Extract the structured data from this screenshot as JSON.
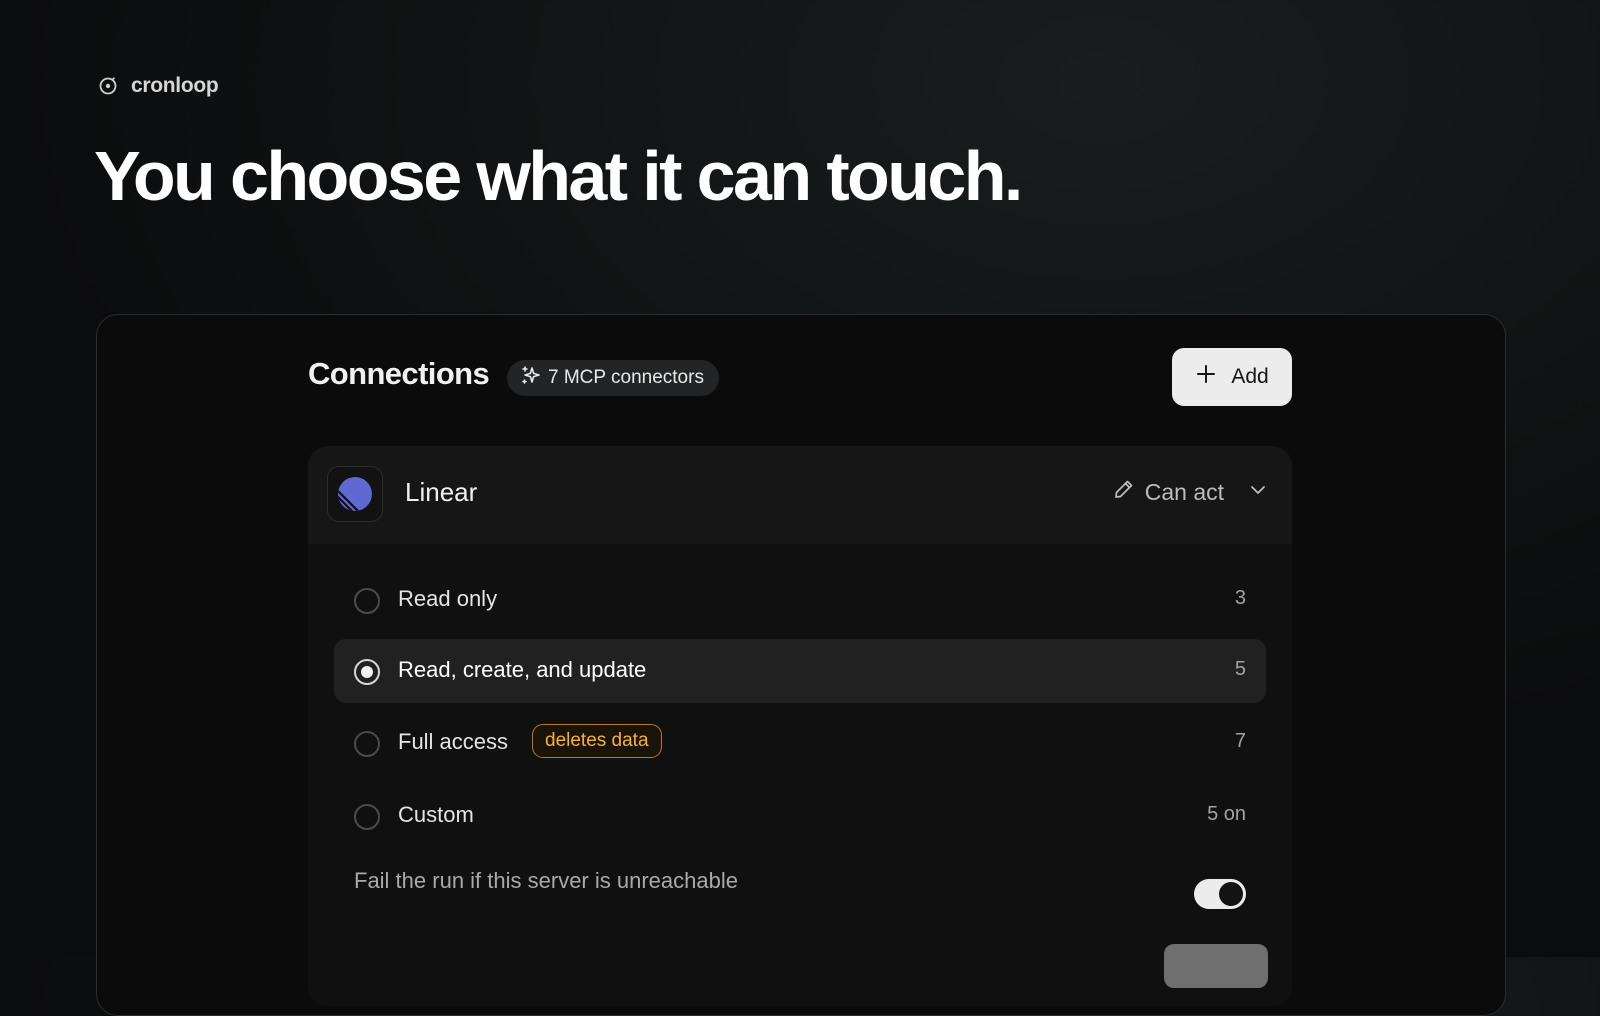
{
  "brand": {
    "name": "cronloop",
    "icon": "circle-dot-icon"
  },
  "headline": "You choose what it can touch.",
  "connections": {
    "title": "Connections",
    "badge": {
      "icon": "sparkle-icon",
      "label": "7 MCP connectors"
    },
    "add_button": {
      "icon": "plus-icon",
      "label": "Add"
    }
  },
  "connector": {
    "name": "Linear",
    "logo": "linear-logo-icon",
    "permission": {
      "icon": "pencil-icon",
      "label": "Can act",
      "dropdown_icon": "chevron-down-icon"
    },
    "options": [
      {
        "label": "Read only",
        "count": "3",
        "selected": false
      },
      {
        "label": "Read, create, and update",
        "count": "5",
        "selected": true
      },
      {
        "label": "Full access",
        "count": "7",
        "selected": false,
        "badge": "deletes data"
      },
      {
        "label": "Custom",
        "count": "5 on",
        "selected": false
      }
    ],
    "fail_toggle": {
      "label": "Fail the run if this server is unreachable",
      "enabled": true
    }
  },
  "colors": {
    "accent_linear": "#5e6ad2",
    "warning": "#f5b431",
    "button_bg": "#ececec"
  }
}
